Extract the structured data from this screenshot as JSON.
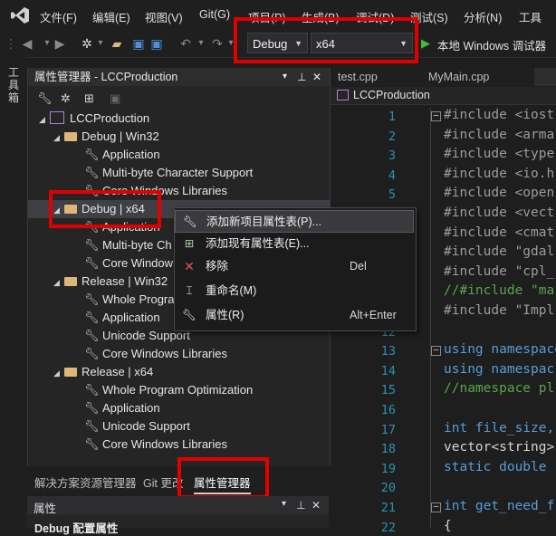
{
  "menu": {
    "items": [
      "文件(F)",
      "编辑(E)",
      "视图(V)",
      "Git(G)",
      "项目(P)",
      "生成(B)",
      "调试(D)",
      "测试(S)",
      "分析(N)",
      "工具"
    ]
  },
  "toolbar": {
    "config": "Debug",
    "platform": "x64",
    "run_label": "本地 Windows 调试器"
  },
  "left_tab": {
    "label": "工具箱"
  },
  "property_manager": {
    "title": "属性管理器 - LCCProduction",
    "pin": "✚",
    "close": "✕",
    "dropdown": "▾",
    "tree": [
      {
        "label": "LCCProduction",
        "kind": "project"
      },
      {
        "label": "Debug | Win32",
        "kind": "folder"
      },
      {
        "label": "Application",
        "kind": "sheet"
      },
      {
        "label": "Multi-byte Character Support",
        "kind": "sheet"
      },
      {
        "label": "Core Windows Libraries",
        "kind": "sheet"
      },
      {
        "label": "Debug | x64",
        "kind": "folder"
      },
      {
        "label": "Application",
        "kind": "sheet"
      },
      {
        "label": "Multi-byte Ch",
        "kind": "sheet"
      },
      {
        "label": "Core Window",
        "kind": "sheet"
      },
      {
        "label": "Release | Win32",
        "kind": "folder"
      },
      {
        "label": "Whole Progra",
        "kind": "sheet"
      },
      {
        "label": "Application",
        "kind": "sheet"
      },
      {
        "label": "Unicode Support",
        "kind": "sheet"
      },
      {
        "label": "Core Windows Libraries",
        "kind": "sheet"
      },
      {
        "label": "Release | x64",
        "kind": "folder"
      },
      {
        "label": "Whole Program Optimization",
        "kind": "sheet"
      },
      {
        "label": "Application",
        "kind": "sheet"
      },
      {
        "label": "Unicode Support",
        "kind": "sheet"
      },
      {
        "label": "Core Windows Libraries",
        "kind": "sheet"
      }
    ]
  },
  "bottom_tabs": [
    "解决方案资源管理器",
    "Git 更改",
    "属性管理器"
  ],
  "properties_panel": {
    "title": "属性",
    "subtitle": "Debug 配置属性"
  },
  "editor": {
    "tabs": [
      "test.cpp",
      "MyMain.cpp"
    ],
    "scope": "LCCProduction",
    "line_numbers": [
      "1",
      "2",
      "3",
      "4",
      "5",
      "6",
      "7",
      "8",
      "9",
      "10",
      "11",
      "12",
      "13",
      "14",
      "15",
      "16",
      "17",
      "18",
      "19",
      "20",
      "21",
      "22"
    ],
    "lines": [
      "#include <iost",
      "#include <arma",
      "#include <type",
      "#include <io.h",
      "#include <open",
      "#include <vect",
      "#include <cmat",
      "#include \"gdal",
      "#include \"cpl_",
      "//#include \"ma",
      "#include \"Impl",
      "",
      "using namespace",
      "using namespac",
      "//namespace pl",
      "",
      "int file_size,",
      "vector<string>",
      "static double",
      "",
      "int get_need_f",
      "{"
    ]
  },
  "context_menu": {
    "items": [
      {
        "label": "添加新项目属性表(P)...",
        "shortcut": "",
        "icon": "wrench-add-icon"
      },
      {
        "label": "添加现有属性表(E)...",
        "shortcut": "",
        "icon": "add-existing-icon"
      },
      {
        "label": "移除",
        "shortcut": "Del",
        "icon": "remove-x-icon"
      },
      {
        "label": "重命名(M)",
        "shortcut": "",
        "icon": "rename-icon"
      },
      {
        "label": "属性(R)",
        "shortcut": "Alt+Enter",
        "icon": "wrench-icon"
      }
    ]
  },
  "colors": {
    "highlight": "#e00000",
    "keyword": "#569cd6",
    "string": "#d69d85",
    "comment": "#57a64a",
    "line_number": "#2b91af"
  }
}
